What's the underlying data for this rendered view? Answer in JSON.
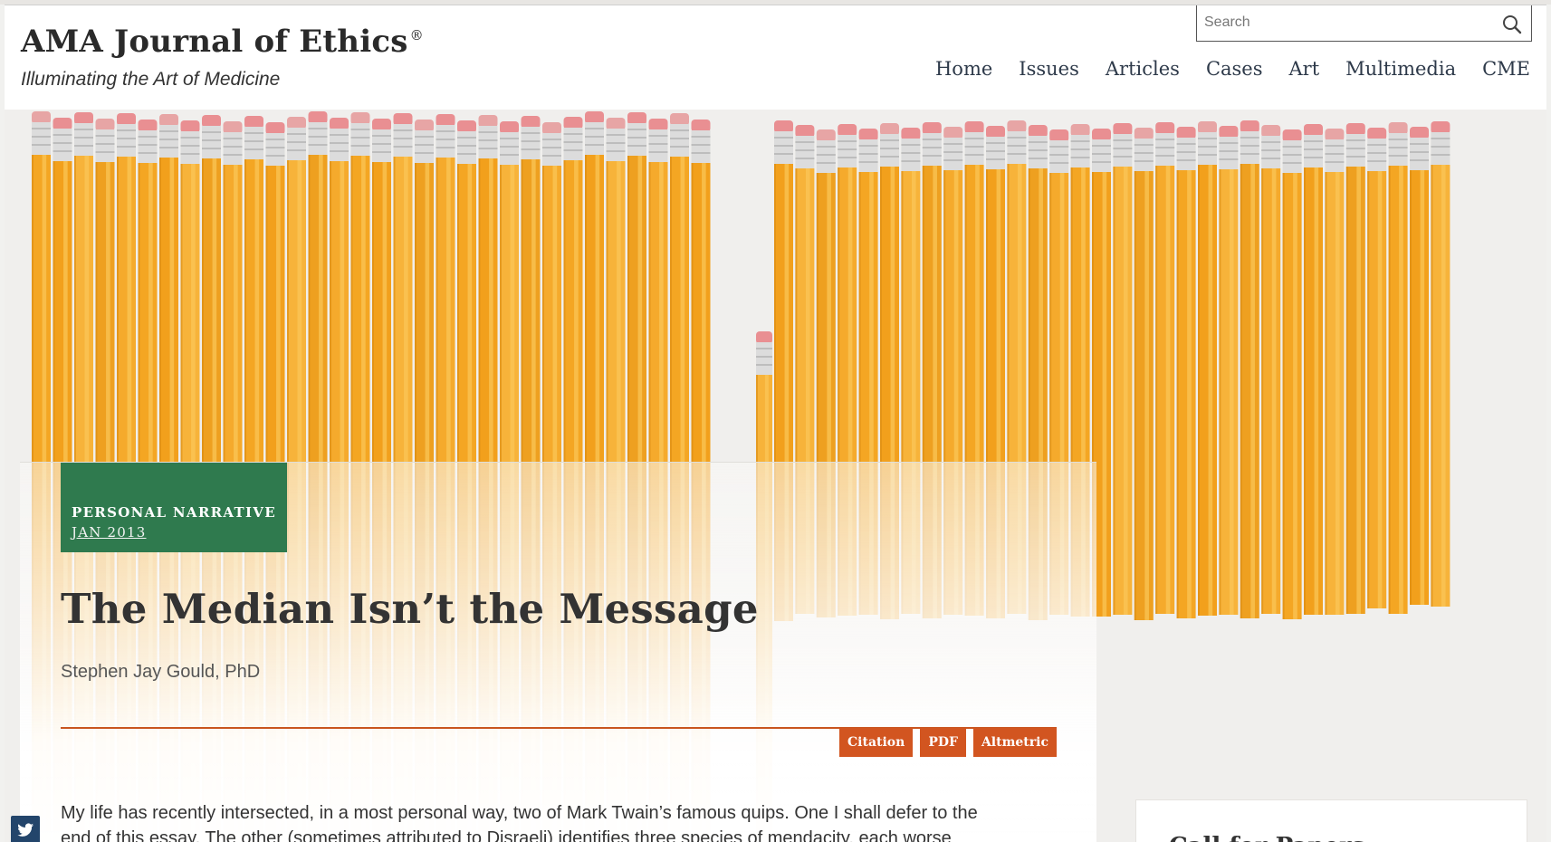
{
  "header": {
    "brand_title": "AMA Journal of Ethics",
    "brand_reg": "®",
    "tagline": "Illuminating the Art of Medicine",
    "search_placeholder": "Search",
    "nav": [
      "Home",
      "Issues",
      "Articles",
      "Cases",
      "Art",
      "Multimedia",
      "CME"
    ]
  },
  "article": {
    "type": "PERSONAL NARRATIVE",
    "date": "JAN 2013",
    "title": "The Median Isn’t the Message",
    "author": "Stephen Jay Gould, PhD",
    "tools": [
      "Citation",
      "PDF",
      "Altmetric"
    ],
    "body_lines": [
      "My life has recently intersected, in a most personal way, two of Mark Twain’s famous quips. One I shall defer to the",
      "end of this essay. The other (sometimes attributed to Disraeli) identifies three species of mendacity, each worse"
    ]
  },
  "sidebar": {
    "card_title": "Call for Papers"
  },
  "icons": {
    "search": "search-icon",
    "twitter": "twitter-icon"
  },
  "colors": {
    "badge_green": "#2f7a4e",
    "accent_orange": "#d25520",
    "pencil_yellow": "#f0a020",
    "twitter_button": "#23456b"
  }
}
